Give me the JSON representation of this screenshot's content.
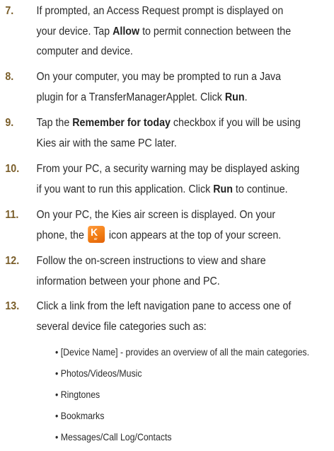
{
  "steps": [
    {
      "num": "7.",
      "line1_before": "If prompted, an Access Request prompt is displayed on",
      "line2": "your device. Tap ",
      "line2_bold": "Allow",
      "line2_after": " to permit connection between the",
      "line3": "computer and device."
    },
    {
      "num": "8.",
      "line1": "On your computer, you may be prompted to run a Java",
      "line2": "plugin for a TransferManagerApplet. Click ",
      "line2_bold": "Run",
      "line2_after": "."
    },
    {
      "num": "9.",
      "line1_before": "Tap the ",
      "line1_bold": "Remember for today",
      "line1_after": " checkbox if you will be using",
      "line2": "Kies air with the same PC later."
    },
    {
      "num": "10.",
      "line1": "From your PC, a security warning may be displayed asking",
      "line2": "if you want to run this application. Click ",
      "line2_bold": "Run",
      "line2_after": "  to continue."
    },
    {
      "num": "11.",
      "line1": "On your PC, the Kies air screen is displayed. On your",
      "line2_before": "phone, the",
      "line2_after": "icon appears at the top of your screen."
    },
    {
      "num": "12.",
      "line1": "Follow the on-screen instructions to view and share",
      "line2": "information between your phone and PC."
    },
    {
      "num": "13.",
      "line1": "Click a link from the left navigation pane to access one of",
      "line2": "several device file categories such as:"
    }
  ],
  "icon": {
    "name": "kies-air-icon",
    "glyph": "K",
    "sub": "air",
    "color": "#f07a10"
  },
  "bullets": [
    "[Device Name] - provides an overview of all the main categories.",
    "Photos/Videos/Music",
    "Ringtones",
    "Bookmarks",
    "Messages/Call Log/Contacts"
  ],
  "bullet_char": "•"
}
